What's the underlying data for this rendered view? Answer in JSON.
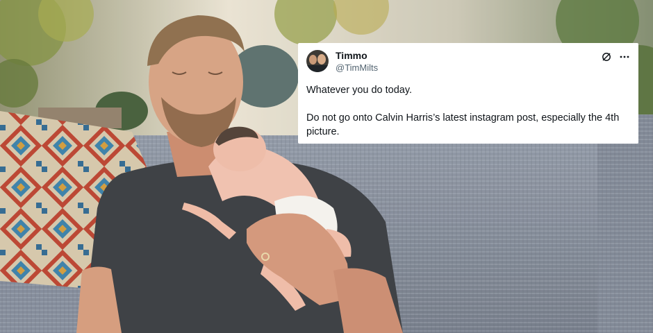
{
  "tweet": {
    "display_name": "Timmo",
    "handle": "@TimMilts",
    "line1": "Whatever you do today.",
    "line2": "Do not go onto Calvin Harris’s latest instagram post, especially the 4th picture."
  },
  "icons": {
    "mute": "mute-icon",
    "more": "more-icon",
    "avatar": "avatar"
  },
  "colors": {
    "card_bg": "#ffffff",
    "text": "#0f1419",
    "handle": "#536471"
  }
}
